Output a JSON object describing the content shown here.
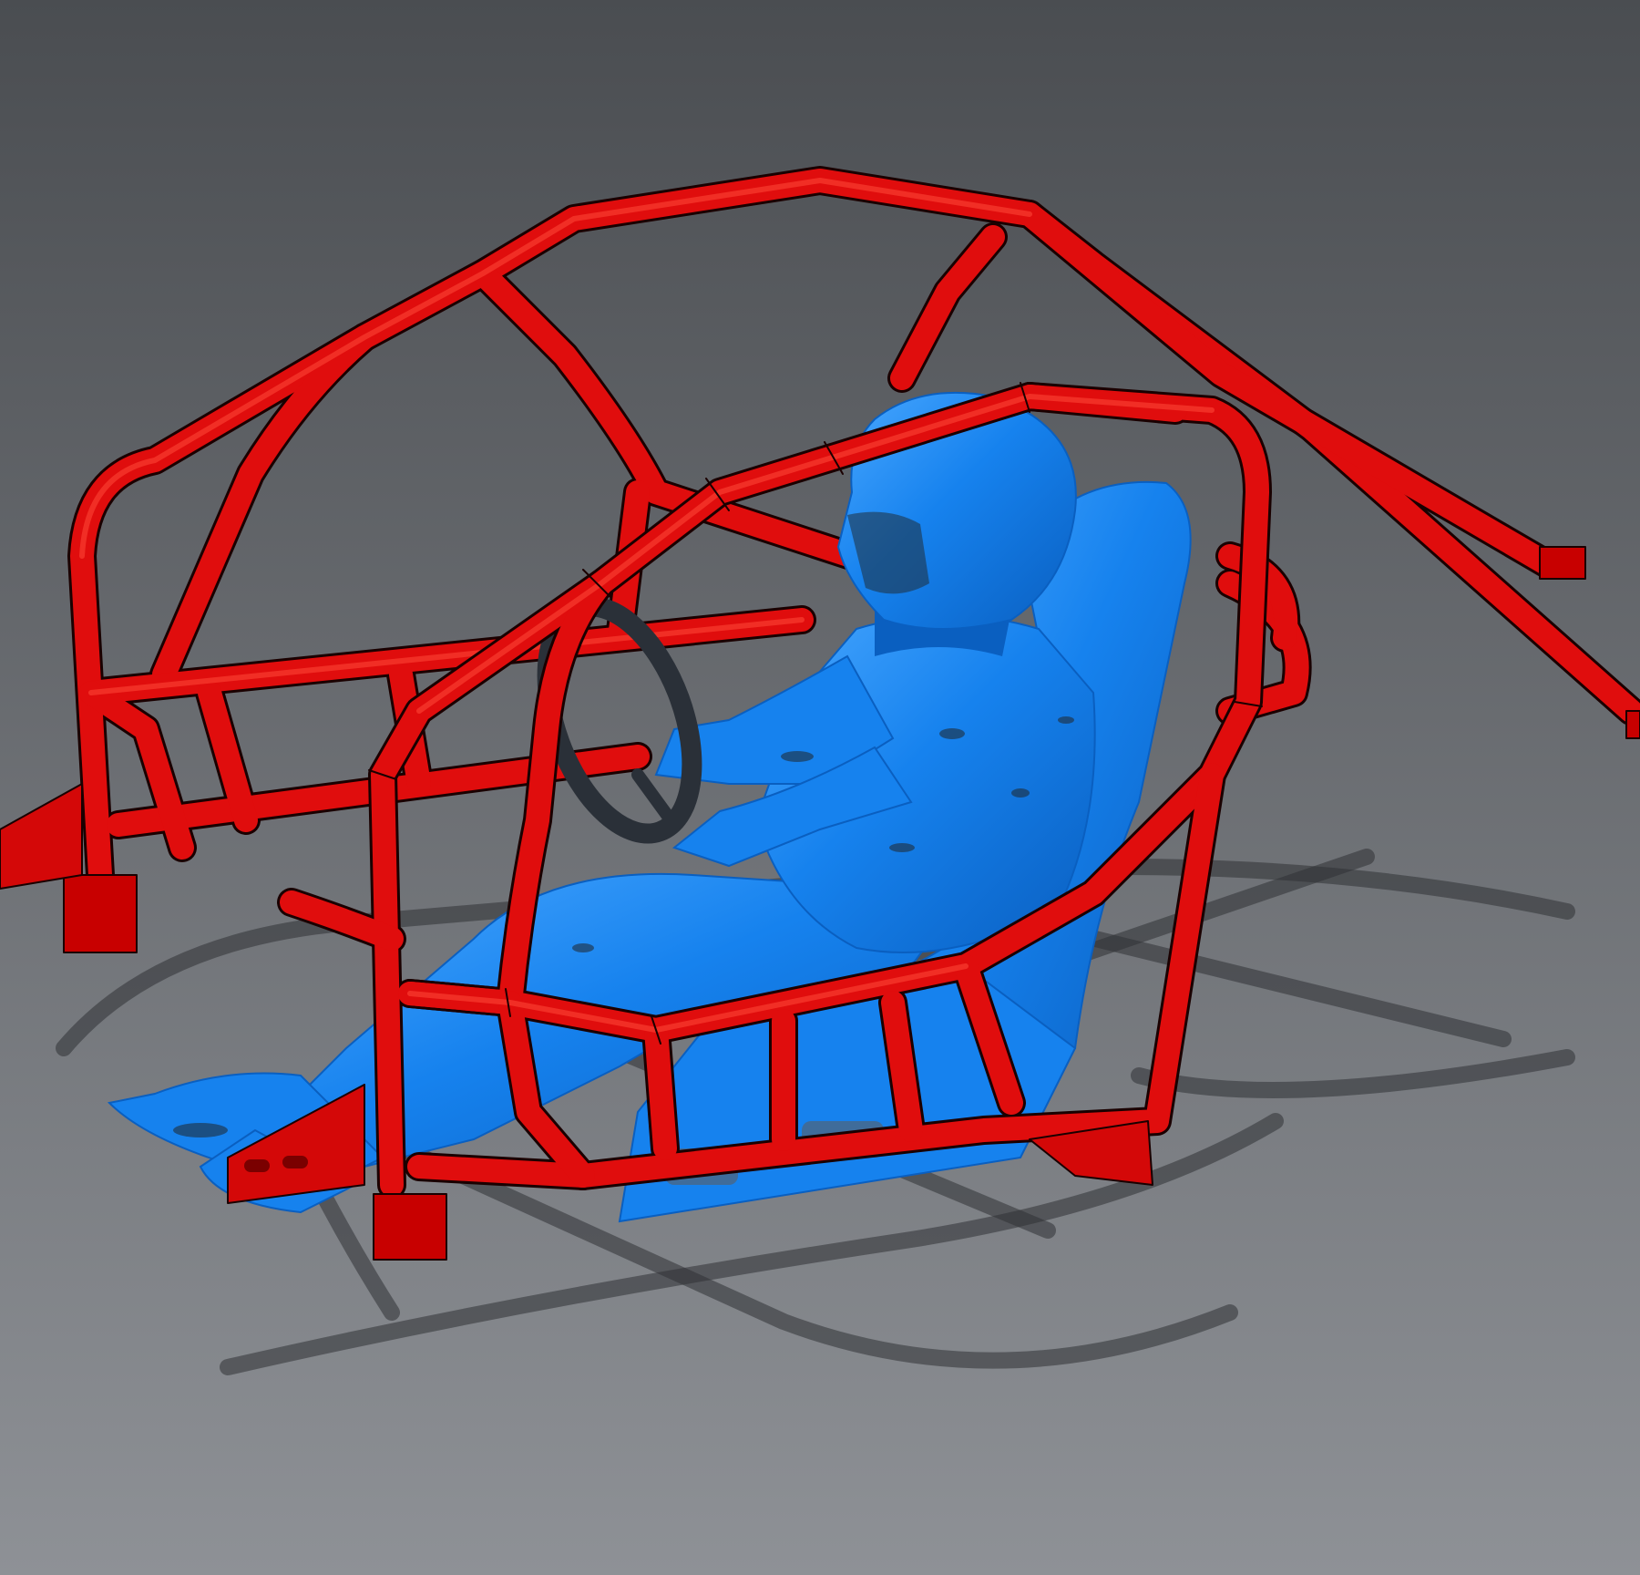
{
  "viewport": {
    "background_top": "#4a4d51",
    "background_bottom": "#8e9196",
    "shadow_color": "#2f3134",
    "shadow_opacity": 0.55
  },
  "scene": {
    "cage": {
      "color": "#e00d0d",
      "shade": "#9c0000",
      "highlight": "#ff4a3a",
      "outline": "#1a0000"
    },
    "occupant": {
      "color": "#1682ee",
      "shade": "#0a5fc0",
      "highlight": "#4aa8ff",
      "dark_patch": "#1f2d3a"
    },
    "steering_wheel": {
      "color": "#2a3038"
    }
  }
}
